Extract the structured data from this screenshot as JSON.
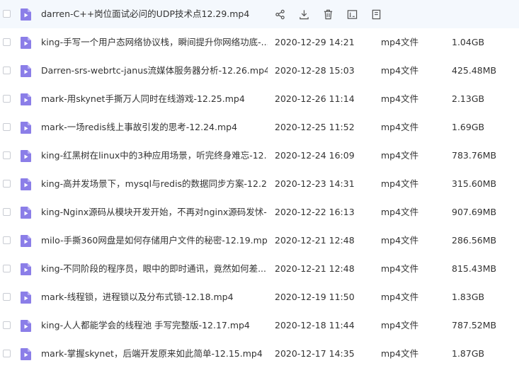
{
  "file_list": {
    "hover_row": 0,
    "file_icon_color": "#8b7ee8",
    "row_actions": {
      "icons": [
        "share-icon",
        "download-icon",
        "delete-icon",
        "rename-icon",
        "more-icon"
      ]
    },
    "rows": [
      {
        "name": "darren-C++岗位面试必问的UDP技术点12.29.mp4",
        "date": "",
        "type": "",
        "size": ""
      },
      {
        "name": "king-手写一个用户态网络协议栈，瞬间提升你网络功底-...",
        "date": "2020-12-29 14:21",
        "type": "mp4文件",
        "size": "1.04GB"
      },
      {
        "name": "Darren-srs-webrtc-janus流媒体服务器分析-12.26.mp4",
        "date": "2020-12-28 15:03",
        "type": "mp4文件",
        "size": "425.48MB"
      },
      {
        "name": "mark-用skynet手撕万人同时在线游戏-12.25.mp4",
        "date": "2020-12-26 11:14",
        "type": "mp4文件",
        "size": "2.13GB"
      },
      {
        "name": "mark-一场redis线上事故引发的思考-12.24.mp4",
        "date": "2020-12-25 11:52",
        "type": "mp4文件",
        "size": "1.69GB"
      },
      {
        "name": "king-红黑树在linux中的3种应用场景，听完终身难忘-12....",
        "date": "2020-12-24 16:09",
        "type": "mp4文件",
        "size": "783.76MB"
      },
      {
        "name": "king-高并发场景下，mysql与redis的数据同步方案-12.2...",
        "date": "2020-12-23 14:31",
        "type": "mp4文件",
        "size": "315.60MB"
      },
      {
        "name": "king-Nginx源码从模块开发开始，不再对nginx源码发怵-...",
        "date": "2020-12-22 16:13",
        "type": "mp4文件",
        "size": "907.69MB"
      },
      {
        "name": "milo-手撕360网盘是如何存储用户文件的秘密-12.19.mp4",
        "date": "2020-12-21 12:48",
        "type": "mp4文件",
        "size": "286.56MB"
      },
      {
        "name": "king-不同阶段的程序员，眼中的即时通讯，竟然如何差...",
        "date": "2020-12-21 12:48",
        "type": "mp4文件",
        "size": "815.43MB"
      },
      {
        "name": "mark-线程锁，进程锁以及分布式锁-12.18.mp4",
        "date": "2020-12-19 11:50",
        "type": "mp4文件",
        "size": "1.83GB"
      },
      {
        "name": "king-人人都能学会的线程池 手写完整版-12.17.mp4",
        "date": "2020-12-18 11:44",
        "type": "mp4文件",
        "size": "787.52MB"
      },
      {
        "name": "mark-掌握skynet，后端开发原来如此简单-12.15.mp4",
        "date": "2020-12-17 14:35",
        "type": "mp4文件",
        "size": "1.87GB"
      }
    ]
  }
}
